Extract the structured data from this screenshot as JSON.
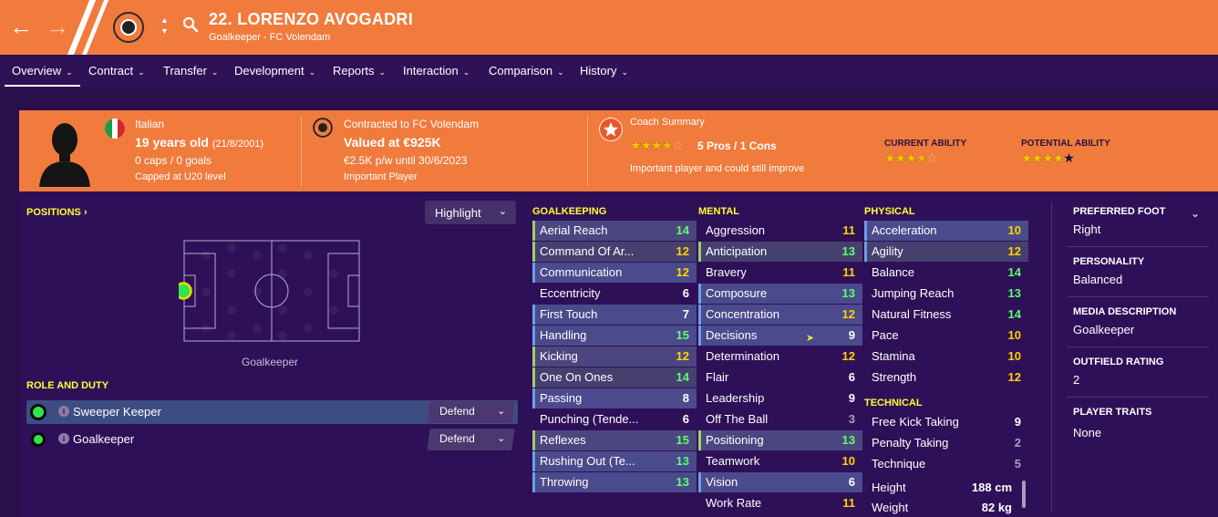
{
  "header": {
    "player_name": "22. LORENZO AVOGADRI",
    "subtitle": "Goalkeeper - FC Volendam",
    "back_icon": "arrow-left-icon",
    "forward_icon": "arrow-right-icon",
    "brand_color": "#f07b3d"
  },
  "tabs": [
    {
      "label": "Overview"
    },
    {
      "label": "Contract"
    },
    {
      "label": "Transfer"
    },
    {
      "label": "Development"
    },
    {
      "label": "Reports"
    },
    {
      "label": "Interaction"
    },
    {
      "label": "Comparison"
    },
    {
      "label": "History"
    }
  ],
  "overview": {
    "nationality": "Italian",
    "age": "19 years old",
    "dob": "(21/8/2001)",
    "caps": "0 caps / 0 goals",
    "capped_level": "Capped at U20 level",
    "contract": "Contracted to FC Volendam",
    "value": "Valued at €925K",
    "wage": "€2.5K p/w until 30/6/2023",
    "status": "Important Player",
    "coach_summary_label": "Coach Summary",
    "pros_cons": "5 Pros / 1 Cons",
    "coach_note": "Important player and could still improve",
    "current_ability_label": "CURRENT ABILITY",
    "potential_ability_label": "POTENTIAL ABILITY",
    "coach_stars": 3.5,
    "current_ability_stars": 3.5,
    "potential_ability_stars": 4.5
  },
  "positions": {
    "title": "POSITIONS",
    "highlight_label": "Highlight",
    "pitch_label": "Goalkeeper"
  },
  "role_duty": {
    "title": "ROLE AND DUTY",
    "roles": [
      {
        "name": "Sweeper Keeper",
        "duty": "Defend"
      },
      {
        "name": "Goalkeeper",
        "duty": "Defend"
      }
    ]
  },
  "goalkeeping": {
    "title": "GOALKEEPING",
    "attrs": [
      {
        "name": "Aerial Reach",
        "value": "14"
      },
      {
        "name": "Command Of Ar...",
        "value": "12"
      },
      {
        "name": "Communication",
        "value": "12"
      },
      {
        "name": "Eccentricity",
        "value": "6"
      },
      {
        "name": "First Touch",
        "value": "7"
      },
      {
        "name": "Handling",
        "value": "15"
      },
      {
        "name": "Kicking",
        "value": "12"
      },
      {
        "name": "One On Ones",
        "value": "14"
      },
      {
        "name": "Passing",
        "value": "8"
      },
      {
        "name": "Punching (Tende...",
        "value": "6"
      },
      {
        "name": "Reflexes",
        "value": "15"
      },
      {
        "name": "Rushing Out (Te...",
        "value": "13"
      },
      {
        "name": "Throwing",
        "value": "13"
      }
    ]
  },
  "mental": {
    "title": "MENTAL",
    "attrs": [
      {
        "name": "Aggression",
        "value": "11"
      },
      {
        "name": "Anticipation",
        "value": "13"
      },
      {
        "name": "Bravery",
        "value": "11"
      },
      {
        "name": "Composure",
        "value": "13"
      },
      {
        "name": "Concentration",
        "value": "12"
      },
      {
        "name": "Decisions",
        "value": "9"
      },
      {
        "name": "Determination",
        "value": "12"
      },
      {
        "name": "Flair",
        "value": "6"
      },
      {
        "name": "Leadership",
        "value": "9"
      },
      {
        "name": "Off The Ball",
        "value": "3"
      },
      {
        "name": "Positioning",
        "value": "13"
      },
      {
        "name": "Teamwork",
        "value": "10"
      },
      {
        "name": "Vision",
        "value": "6"
      },
      {
        "name": "Work Rate",
        "value": "11"
      }
    ]
  },
  "physical": {
    "title": "PHYSICAL",
    "attrs": [
      {
        "name": "Acceleration",
        "value": "10"
      },
      {
        "name": "Agility",
        "value": "12"
      },
      {
        "name": "Balance",
        "value": "14"
      },
      {
        "name": "Jumping Reach",
        "value": "13"
      },
      {
        "name": "Natural Fitness",
        "value": "14"
      },
      {
        "name": "Pace",
        "value": "10"
      },
      {
        "name": "Stamina",
        "value": "10"
      },
      {
        "name": "Strength",
        "value": "12"
      }
    ]
  },
  "technical": {
    "title": "TECHNICAL",
    "attrs": [
      {
        "name": "Free Kick Taking",
        "value": "9"
      },
      {
        "name": "Penalty Taking",
        "value": "2"
      },
      {
        "name": "Technique",
        "value": "5"
      }
    ]
  },
  "physique": {
    "height_label": "Height",
    "height": "188 cm",
    "weight_label": "Weight",
    "weight": "82 kg"
  },
  "info": {
    "preferred_foot_label": "PREFERRED FOOT",
    "preferred_foot": "Right",
    "personality_label": "PERSONALITY",
    "personality": "Balanced",
    "media_label": "MEDIA DESCRIPTION",
    "media": "Goalkeeper",
    "outfield_label": "OUTFIELD RATING",
    "outfield": "2",
    "traits_label": "PLAYER TRAITS",
    "traits": "None"
  }
}
